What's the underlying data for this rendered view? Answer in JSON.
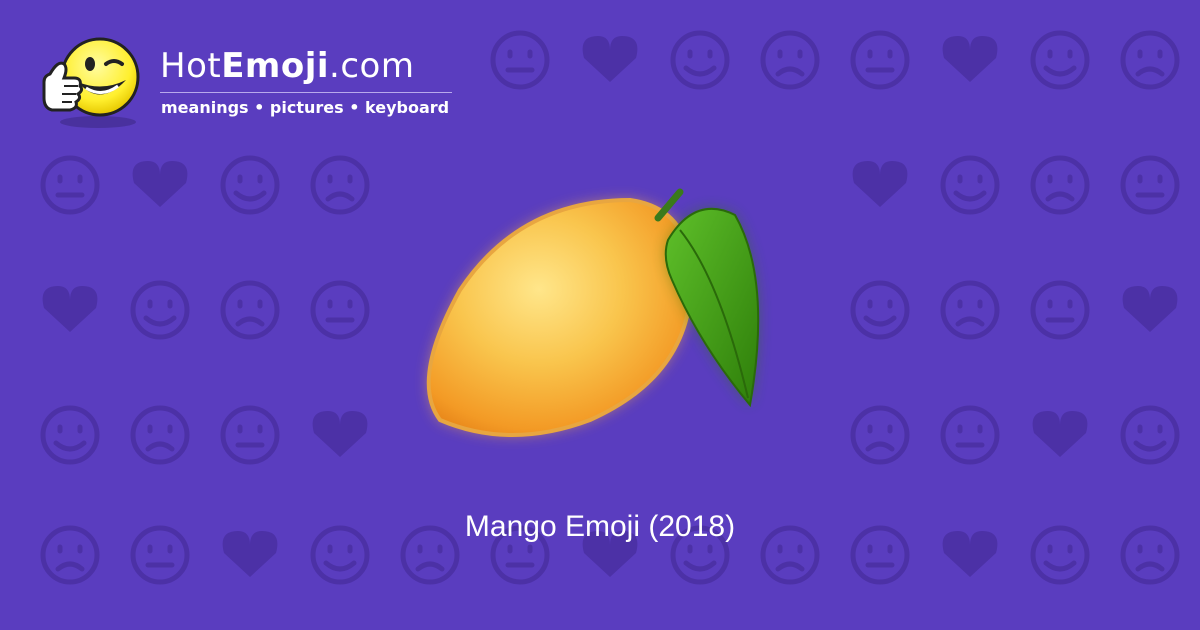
{
  "site": {
    "name_prefix": "Hot",
    "name_bold": "Emoji",
    "name_suffix": ".com",
    "tagline": "meanings • pictures • keyboard"
  },
  "caption": "Mango Emoji (2018)",
  "colors": {
    "background": "#5a3dbf",
    "pattern_icons": "#4c31a6",
    "text": "#ffffff",
    "logo_face": "#ffef2e",
    "mango_body": "#f6b43c",
    "mango_leaf": "#3f9e14"
  },
  "icons": {
    "logo": "thumbs-up-winking-face-icon",
    "main": "mango-icon",
    "background": "emoji-pattern-icons"
  }
}
